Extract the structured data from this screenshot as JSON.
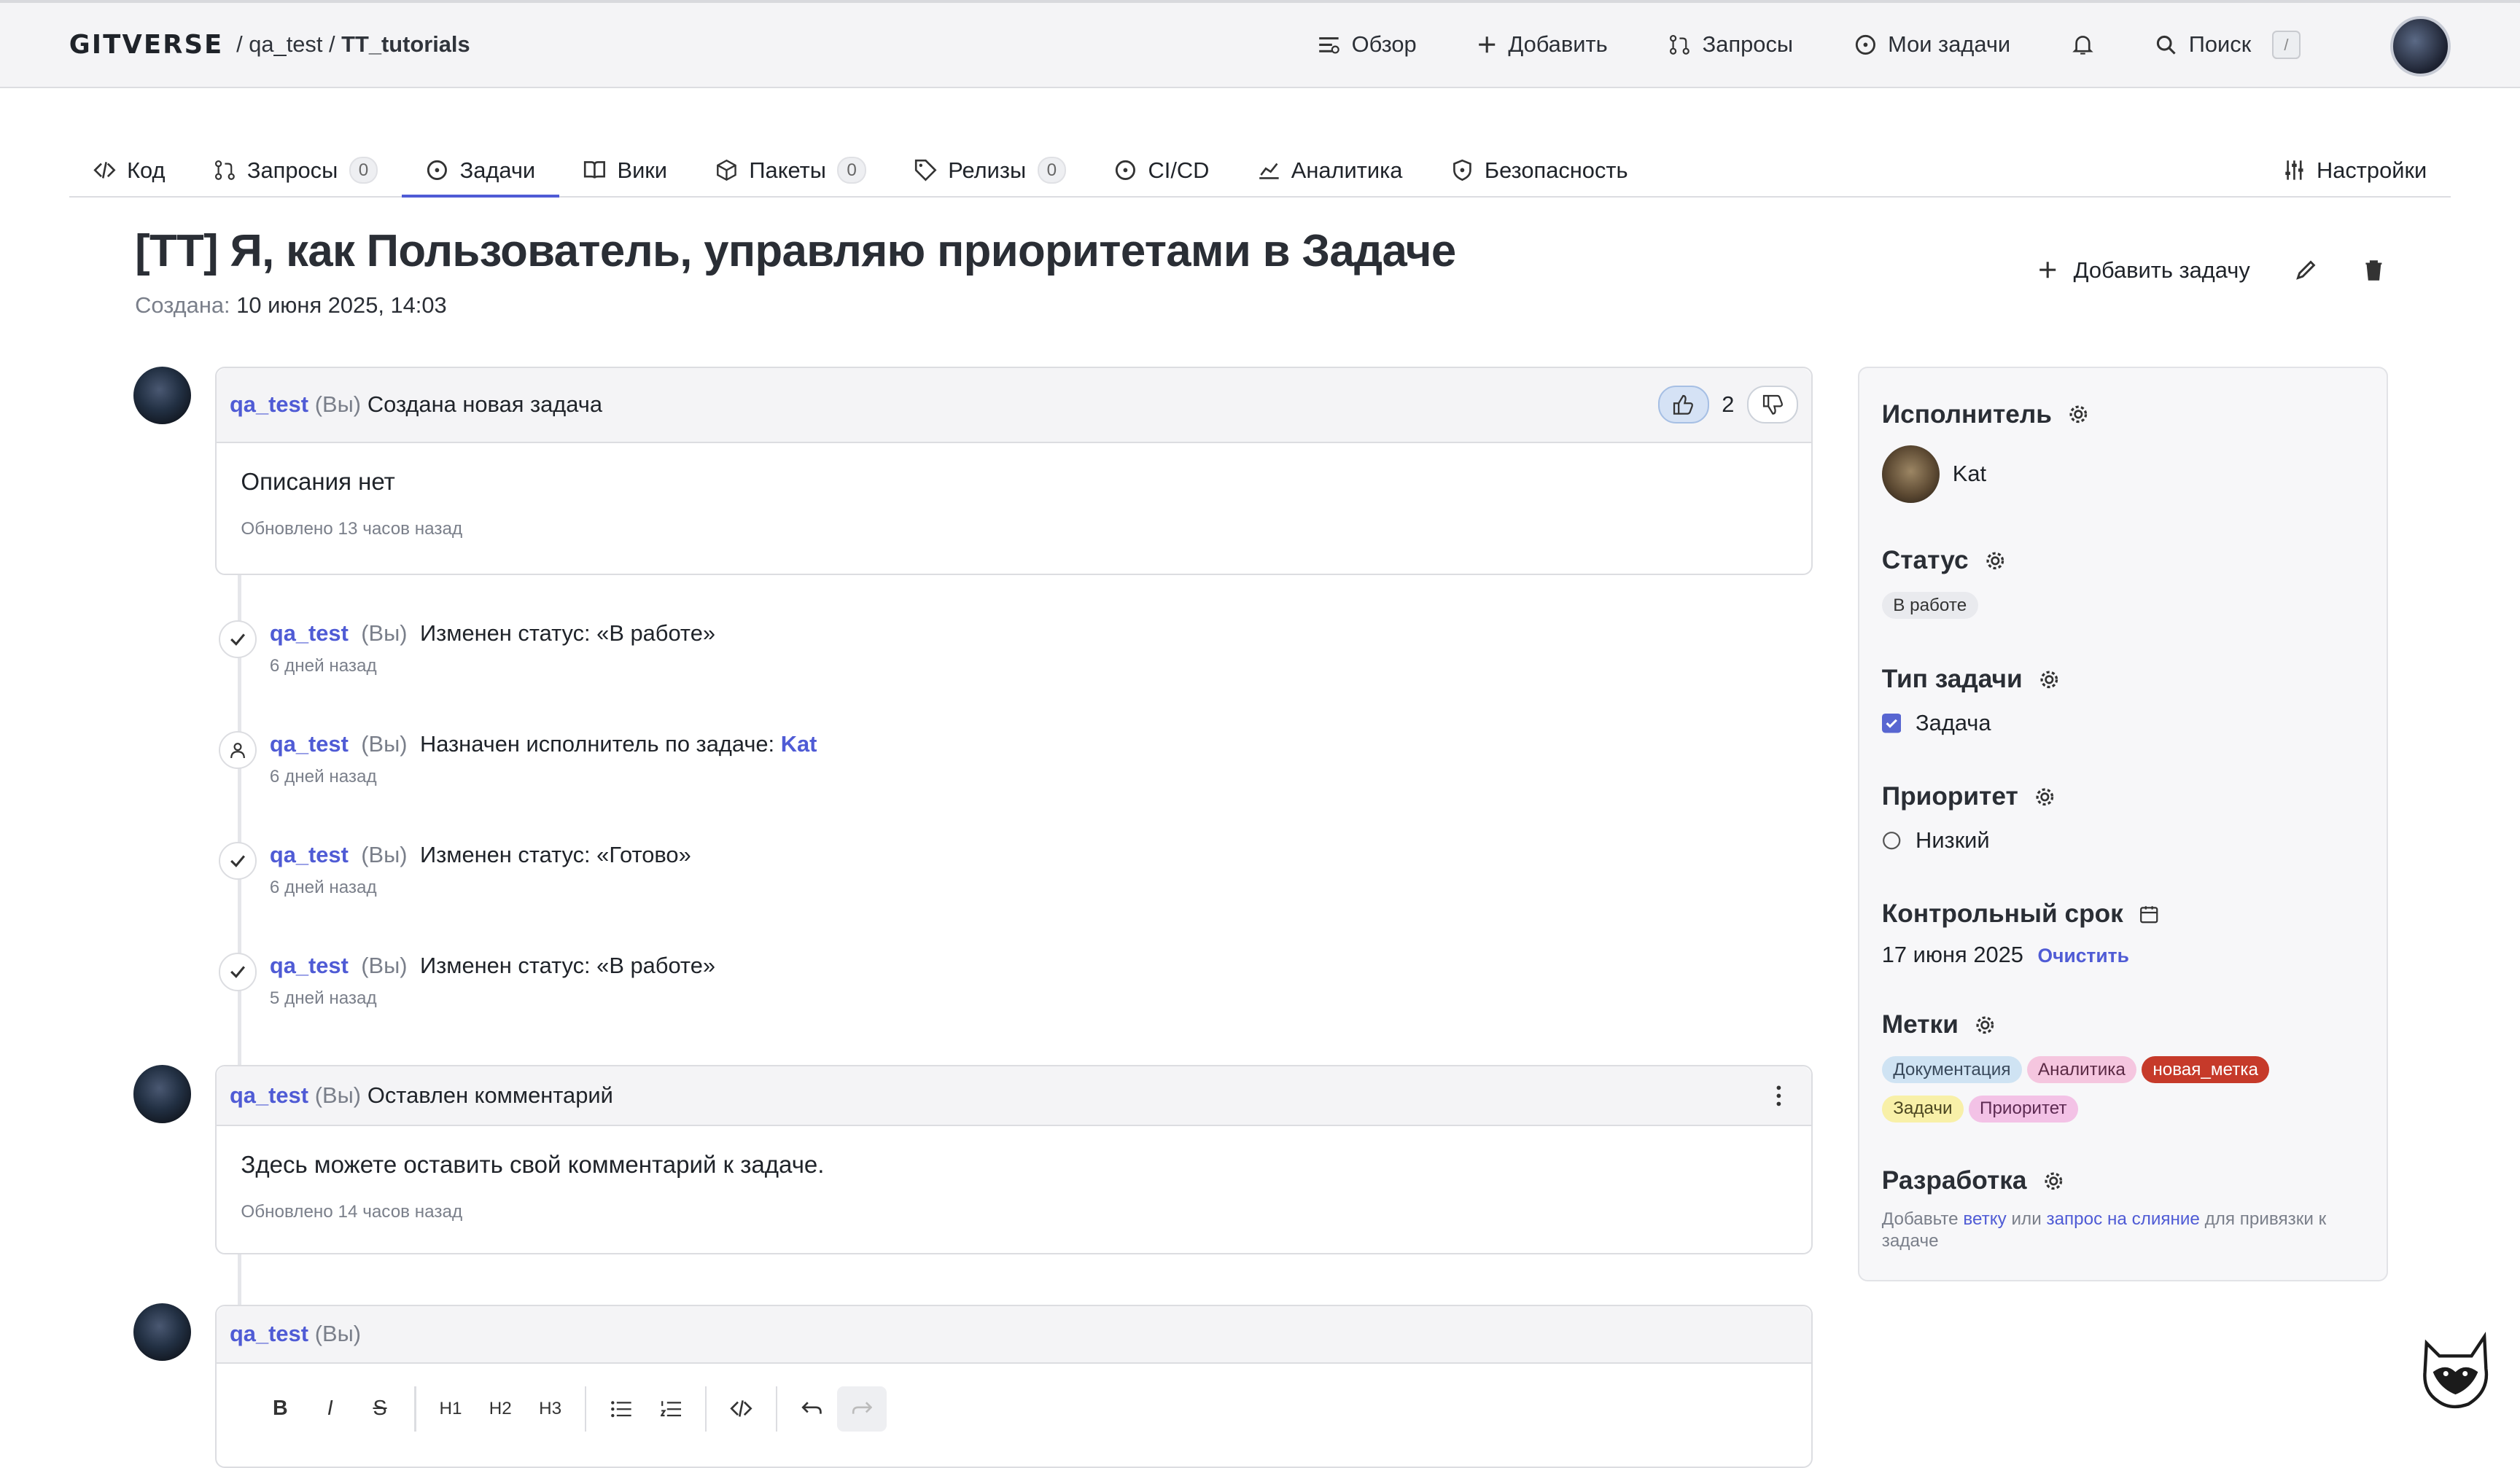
{
  "topbar": {
    "logo": "GITVERSE",
    "owner": "qa_test",
    "repo": "TT_tutorials",
    "nav": [
      "Обзор",
      "Добавить",
      "Запросы",
      "Мои задачи"
    ],
    "search": "Поиск",
    "search_key": "/"
  },
  "tabs": [
    {
      "label": "Код"
    },
    {
      "label": "Запросы",
      "count": "0"
    },
    {
      "label": "Задачи"
    },
    {
      "label": "Вики"
    },
    {
      "label": "Пакеты",
      "count": "0"
    },
    {
      "label": "Релизы",
      "count": "0"
    },
    {
      "label": "CI/CD"
    },
    {
      "label": "Аналитика"
    },
    {
      "label": "Безопасность"
    },
    {
      "label": "Настройки"
    }
  ],
  "issue": {
    "title": "[TT] Я, как Пользователь, управляю приоритетами в Задаче",
    "created_label": "Создана:",
    "created_value": "10 июня 2025, 14:03",
    "add_task": "Добавить задачу"
  },
  "first_card": {
    "user": "qa_test",
    "you": "(Вы)",
    "action": "Создана новая задача",
    "likes": "2",
    "body": "Описания нет",
    "updated": "Обновлено 13 часов назад"
  },
  "events": [
    {
      "user": "qa_test",
      "you": "(Вы)",
      "text": "Изменен статус: «В работе»",
      "time": "6 дней назад"
    },
    {
      "user": "qa_test",
      "you": "(Вы)",
      "text": "Назначен исполнитель по задаче:",
      "link": "Kat",
      "time": "6 дней назад"
    },
    {
      "user": "qa_test",
      "you": "(Вы)",
      "text": "Изменен статус: «Готово»",
      "time": "6 дней назад"
    },
    {
      "user": "qa_test",
      "you": "(Вы)",
      "text": "Изменен статус: «В работе»",
      "time": "5 дней назад"
    }
  ],
  "comment": {
    "user": "qa_test",
    "you": "(Вы)",
    "action": "Оставлен комментарий",
    "body": "Здесь можете оставить свой комментарий к задаче.",
    "updated": "Обновлено 14 часов назад"
  },
  "editor": {
    "user": "qa_test",
    "you": "(Вы)",
    "toolbar": [
      "B",
      "I",
      "S",
      "H1",
      "H2",
      "H3"
    ]
  },
  "sidebar": {
    "assignee_title": "Исполнитель",
    "assignee": "Kat",
    "status_title": "Статус",
    "status": "В работе",
    "type_title": "Тип задачи",
    "type": "Задача",
    "priority_title": "Приоритет",
    "priority": "Низкий",
    "due_title": "Контрольный срок",
    "due": "17 июня 2025",
    "clear": "Очистить",
    "labels_title": "Метки",
    "labels": [
      {
        "text": "Документация",
        "bg": "#cfe3f3",
        "fg": "#3a4a5c"
      },
      {
        "text": "Аналитика",
        "bg": "#f5c6df",
        "fg": "#5b2a45"
      },
      {
        "text": "новая_метка",
        "bg": "#c63a2a",
        "fg": "#ffffff"
      },
      {
        "text": "Задачи",
        "bg": "#f8f0a8",
        "fg": "#4b4620"
      },
      {
        "text": "Приоритет",
        "bg": "#f3c2e6",
        "fg": "#5d2a52"
      }
    ],
    "dev_title": "Разработка",
    "dev_text1": "Добавьте",
    "dev_link1": "ветку",
    "dev_text2": "или",
    "dev_link2": "запрос на слияние",
    "dev_text3": "для привязки к задаче"
  }
}
